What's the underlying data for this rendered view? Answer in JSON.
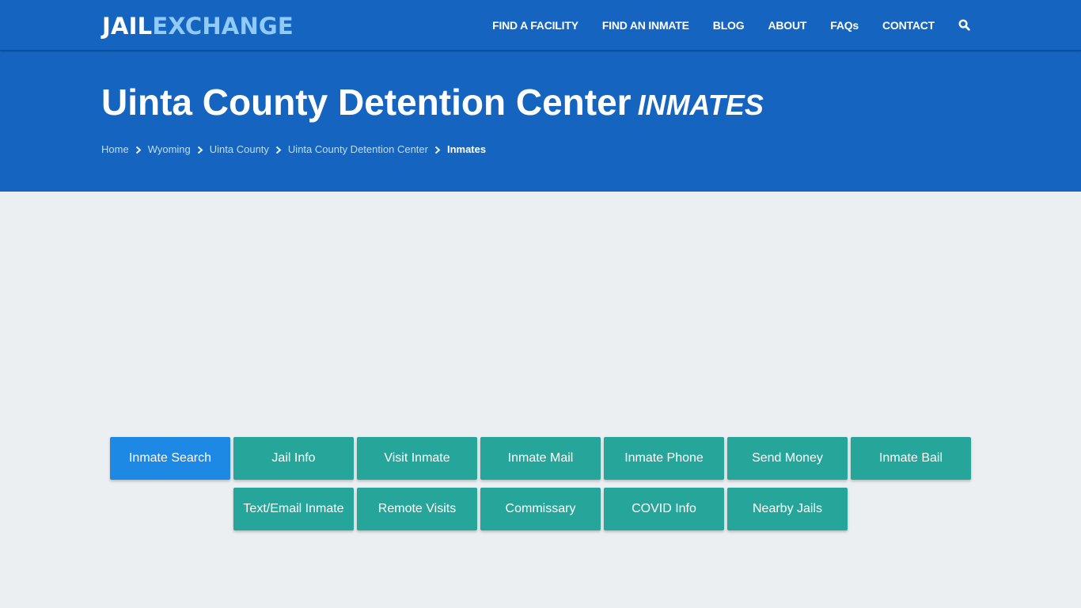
{
  "header": {
    "logo": {
      "part1": "JAIL",
      "part2": "EXCHANGE"
    },
    "nav": [
      {
        "label": "FIND A FACILITY"
      },
      {
        "label": "FIND AN INMATE"
      },
      {
        "label": "BLOG"
      },
      {
        "label": "ABOUT"
      },
      {
        "label": "FAQs"
      },
      {
        "label": "CONTACT"
      }
    ],
    "search_icon": "search-icon"
  },
  "hero": {
    "title": "Uinta County Detention Center",
    "title_suffix": "INMATES",
    "breadcrumb": [
      {
        "label": "Home"
      },
      {
        "label": "Wyoming"
      },
      {
        "label": "Uinta County"
      },
      {
        "label": "Uinta County Detention Center"
      },
      {
        "label": "Inmates"
      }
    ]
  },
  "buttons": [
    {
      "label": "Inmate Search",
      "active": true
    },
    {
      "label": "Jail Info"
    },
    {
      "label": "Visit Inmate"
    },
    {
      "label": "Inmate Mail"
    },
    {
      "label": "Inmate Phone"
    },
    {
      "label": "Send Money"
    },
    {
      "label": "Inmate Bail"
    },
    {
      "label": "Text/Email Inmate"
    },
    {
      "label": "Remote Visits"
    },
    {
      "label": "Commissary"
    },
    {
      "label": "COVID Info"
    },
    {
      "label": "Nearby Jails"
    }
  ],
  "colors": {
    "primary": "#1565c0",
    "logo_accent": "#90caf9",
    "button": "#26a69a",
    "button_active": "#1e88e5",
    "background": "#ebeff2"
  }
}
